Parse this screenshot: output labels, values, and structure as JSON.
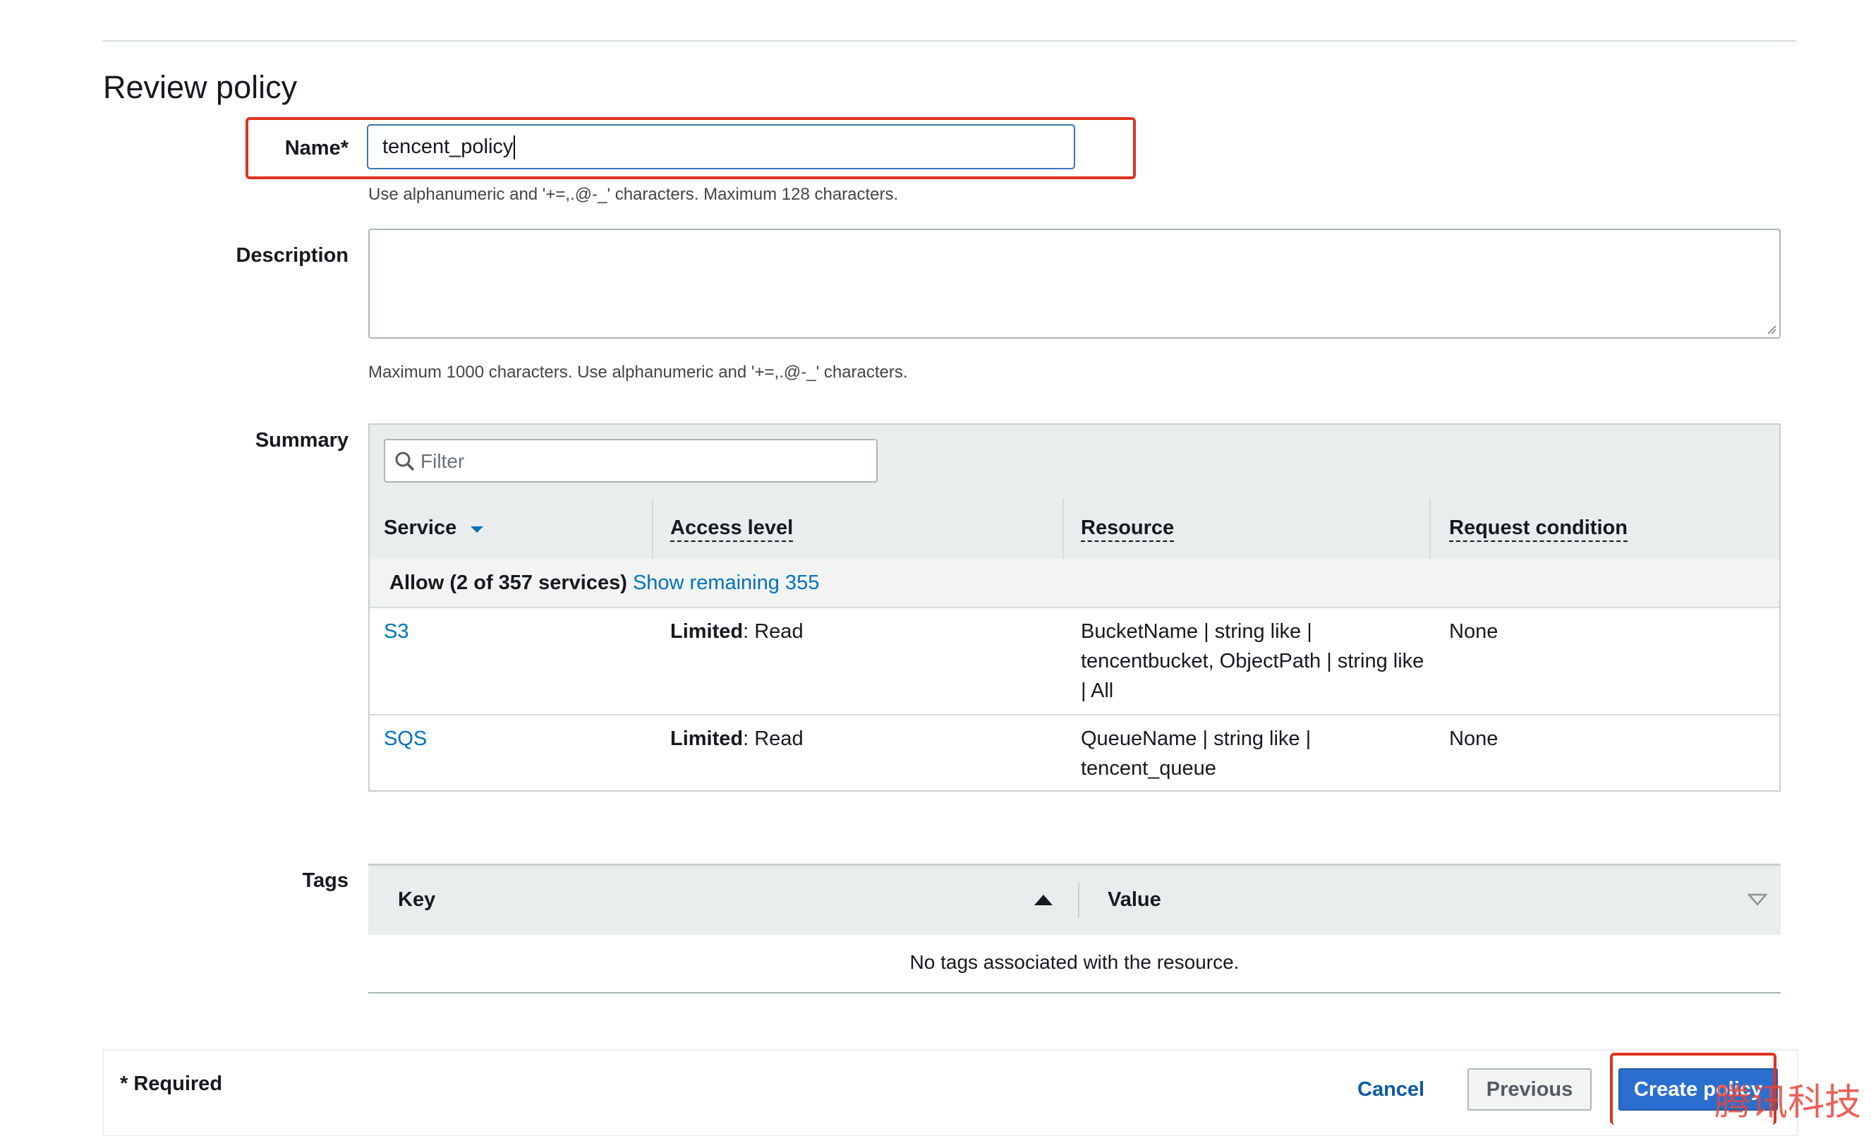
{
  "page": {
    "title": "Review policy"
  },
  "name_field": {
    "label": "Name*",
    "value": "tencent_policy",
    "hint": "Use alphanumeric and '+=,.@-_' characters. Maximum 128 characters."
  },
  "description_field": {
    "label": "Description",
    "value": "",
    "hint": "Maximum 1000 characters. Use alphanumeric and '+=,.@-_' characters."
  },
  "summary": {
    "label": "Summary",
    "filter_placeholder": "Filter",
    "columns": [
      "Service",
      "Access level",
      "Resource",
      "Request condition"
    ],
    "allow_text": "Allow (2 of 357 services)",
    "show_remaining": "Show remaining 355",
    "rows": [
      {
        "service": "S3",
        "access_bold": "Limited",
        "access_rest": ": Read",
        "resource_lines": [
          "BucketName | string like |",
          "tencentbucket, ObjectPath | string like",
          "| All"
        ],
        "condition": "None"
      },
      {
        "service": "SQS",
        "access_bold": "Limited",
        "access_rest": ": Read",
        "resource_lines": [
          "QueueName | string like |",
          "tencent_queue"
        ],
        "condition": "None"
      }
    ]
  },
  "tags": {
    "label": "Tags",
    "key_header": "Key",
    "value_header": "Value",
    "empty_text": "No tags associated with the resource."
  },
  "footer": {
    "required": "* Required",
    "cancel": "Cancel",
    "previous": "Previous",
    "create": "Create policy",
    "watermark": "腾讯科技"
  },
  "colors": {
    "link": "#0073bb",
    "primary_button": "#2a6fcf",
    "highlight": "#e0321e"
  }
}
